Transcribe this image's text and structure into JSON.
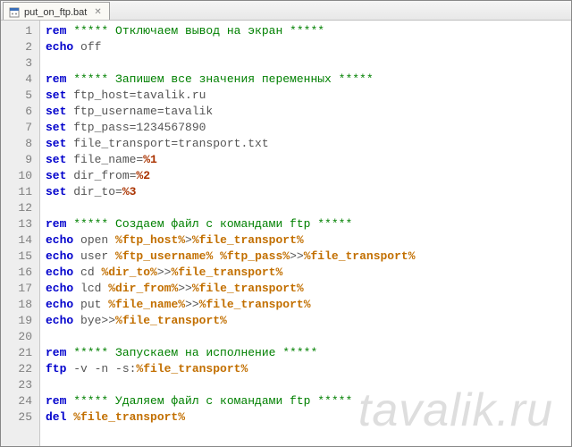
{
  "tab": {
    "filename": "put_on_ftp.bat",
    "close_glyph": "✕"
  },
  "watermark": "tavalik.ru",
  "code": {
    "lines": [
      {
        "n": 1,
        "seg": [
          {
            "c": "kw",
            "t": "rem"
          },
          {
            "c": "cmt",
            "t": " ***** Отключаем вывод на экран *****"
          }
        ]
      },
      {
        "n": 2,
        "seg": [
          {
            "c": "kw",
            "t": "echo"
          },
          {
            "c": "txt",
            "t": " off"
          }
        ]
      },
      {
        "n": 3,
        "seg": []
      },
      {
        "n": 4,
        "seg": [
          {
            "c": "kw",
            "t": "rem"
          },
          {
            "c": "cmt",
            "t": " ***** Запишем все значения переменных *****"
          }
        ]
      },
      {
        "n": 5,
        "seg": [
          {
            "c": "kw",
            "t": "set"
          },
          {
            "c": "txt",
            "t": " ftp_host=tavalik.ru"
          }
        ]
      },
      {
        "n": 6,
        "seg": [
          {
            "c": "kw",
            "t": "set"
          },
          {
            "c": "txt",
            "t": " ftp_username=tavalik"
          }
        ]
      },
      {
        "n": 7,
        "seg": [
          {
            "c": "kw",
            "t": "set"
          },
          {
            "c": "txt",
            "t": " ftp_pass=1234567890"
          }
        ]
      },
      {
        "n": 8,
        "seg": [
          {
            "c": "kw",
            "t": "set"
          },
          {
            "c": "txt",
            "t": " file_transport=transport.txt"
          }
        ]
      },
      {
        "n": 9,
        "seg": [
          {
            "c": "kw",
            "t": "set"
          },
          {
            "c": "txt",
            "t": " file_name="
          },
          {
            "c": "var2",
            "t": "%1"
          }
        ]
      },
      {
        "n": 10,
        "seg": [
          {
            "c": "kw",
            "t": "set"
          },
          {
            "c": "txt",
            "t": " dir_from="
          },
          {
            "c": "var2",
            "t": "%2"
          }
        ]
      },
      {
        "n": 11,
        "seg": [
          {
            "c": "kw",
            "t": "set"
          },
          {
            "c": "txt",
            "t": " dir_to="
          },
          {
            "c": "var2",
            "t": "%3"
          }
        ]
      },
      {
        "n": 12,
        "seg": []
      },
      {
        "n": 13,
        "seg": [
          {
            "c": "kw",
            "t": "rem"
          },
          {
            "c": "cmt",
            "t": " ***** Создаем файл с командами ftp *****"
          }
        ]
      },
      {
        "n": 14,
        "seg": [
          {
            "c": "kw",
            "t": "echo"
          },
          {
            "c": "txt",
            "t": " open "
          },
          {
            "c": "var",
            "t": "%ftp_host%"
          },
          {
            "c": "txt",
            "t": ">"
          },
          {
            "c": "var",
            "t": "%file_transport%"
          }
        ]
      },
      {
        "n": 15,
        "seg": [
          {
            "c": "kw",
            "t": "echo"
          },
          {
            "c": "txt",
            "t": " user "
          },
          {
            "c": "var",
            "t": "%ftp_username%"
          },
          {
            "c": "txt",
            "t": " "
          },
          {
            "c": "var",
            "t": "%ftp_pass%"
          },
          {
            "c": "txt",
            "t": ">>"
          },
          {
            "c": "var",
            "t": "%file_transport%"
          }
        ]
      },
      {
        "n": 16,
        "seg": [
          {
            "c": "kw",
            "t": "echo"
          },
          {
            "c": "txt",
            "t": " cd "
          },
          {
            "c": "var",
            "t": "%dir_to%"
          },
          {
            "c": "txt",
            "t": ">>"
          },
          {
            "c": "var",
            "t": "%file_transport%"
          }
        ]
      },
      {
        "n": 17,
        "seg": [
          {
            "c": "kw",
            "t": "echo"
          },
          {
            "c": "txt",
            "t": " lcd "
          },
          {
            "c": "var",
            "t": "%dir_from%"
          },
          {
            "c": "txt",
            "t": ">>"
          },
          {
            "c": "var",
            "t": "%file_transport%"
          }
        ]
      },
      {
        "n": 18,
        "seg": [
          {
            "c": "kw",
            "t": "echo"
          },
          {
            "c": "txt",
            "t": " put "
          },
          {
            "c": "var",
            "t": "%file_name%"
          },
          {
            "c": "txt",
            "t": ">>"
          },
          {
            "c": "var",
            "t": "%file_transport%"
          }
        ]
      },
      {
        "n": 19,
        "seg": [
          {
            "c": "kw",
            "t": "echo"
          },
          {
            "c": "txt",
            "t": " bye>>"
          },
          {
            "c": "var",
            "t": "%file_transport%"
          }
        ]
      },
      {
        "n": 20,
        "seg": []
      },
      {
        "n": 21,
        "seg": [
          {
            "c": "kw",
            "t": "rem"
          },
          {
            "c": "cmt",
            "t": " ***** Запускаем на исполнение *****"
          }
        ]
      },
      {
        "n": 22,
        "seg": [
          {
            "c": "kw",
            "t": "ftp"
          },
          {
            "c": "txt",
            "t": " -v -n -s:"
          },
          {
            "c": "var",
            "t": "%file_transport%"
          }
        ]
      },
      {
        "n": 23,
        "seg": []
      },
      {
        "n": 24,
        "seg": [
          {
            "c": "kw",
            "t": "rem"
          },
          {
            "c": "cmt",
            "t": " ***** Удаляем файл с командами ftp *****"
          }
        ]
      },
      {
        "n": 25,
        "seg": [
          {
            "c": "kw",
            "t": "del"
          },
          {
            "c": "txt",
            "t": " "
          },
          {
            "c": "var",
            "t": "%file_transport%"
          }
        ]
      }
    ]
  }
}
